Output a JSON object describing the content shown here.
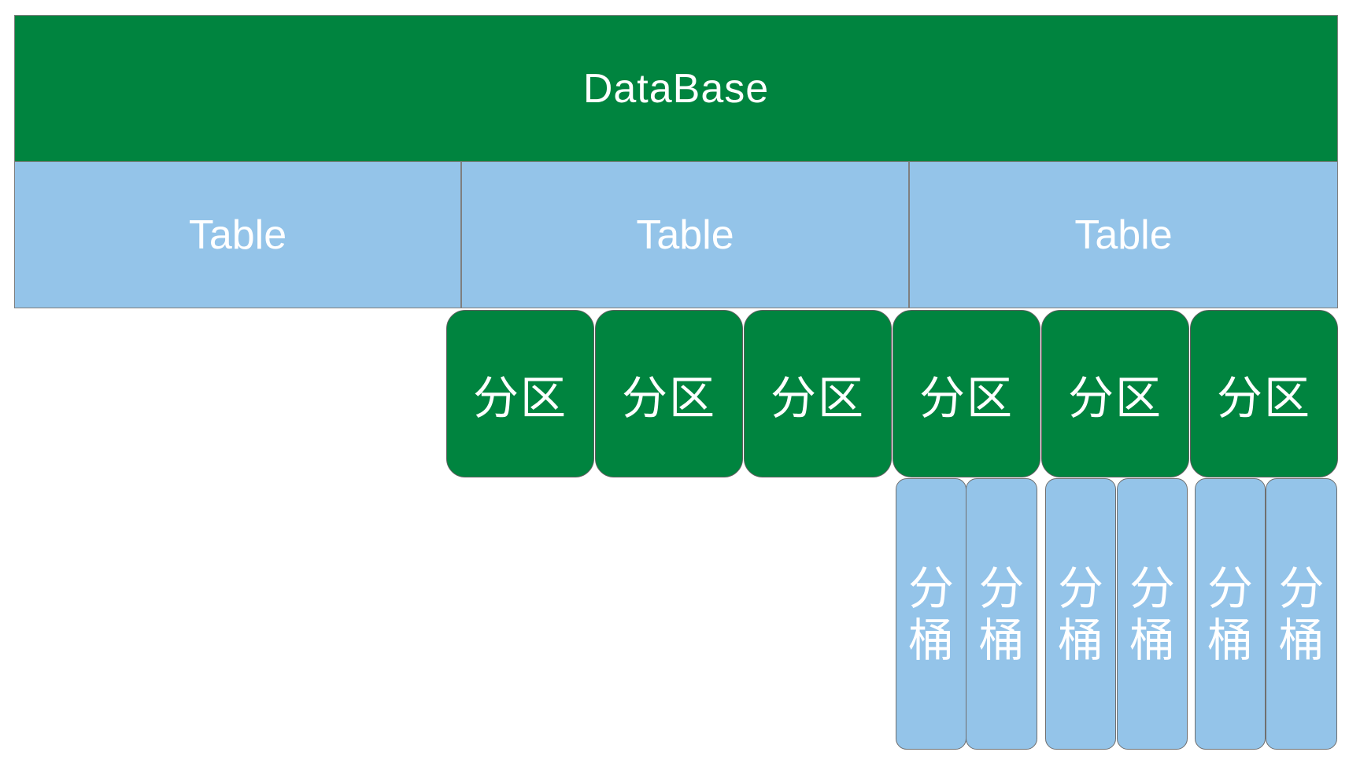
{
  "database": {
    "label": "DataBase"
  },
  "tables": [
    {
      "label": "Table"
    },
    {
      "label": "Table"
    },
    {
      "label": "Table"
    }
  ],
  "partitions": [
    {
      "label": "分区"
    },
    {
      "label": "分区"
    },
    {
      "label": "分区"
    },
    {
      "label": "分区"
    },
    {
      "label": "分区"
    },
    {
      "label": "分区"
    }
  ],
  "buckets": [
    {
      "label": "分桶"
    },
    {
      "label": "分桶"
    },
    {
      "label": "分桶"
    },
    {
      "label": "分桶"
    },
    {
      "label": "分桶"
    },
    {
      "label": "分桶"
    }
  ],
  "colors": {
    "green": "#00843f",
    "blue": "#94c4e9",
    "text": "#ffffff"
  }
}
